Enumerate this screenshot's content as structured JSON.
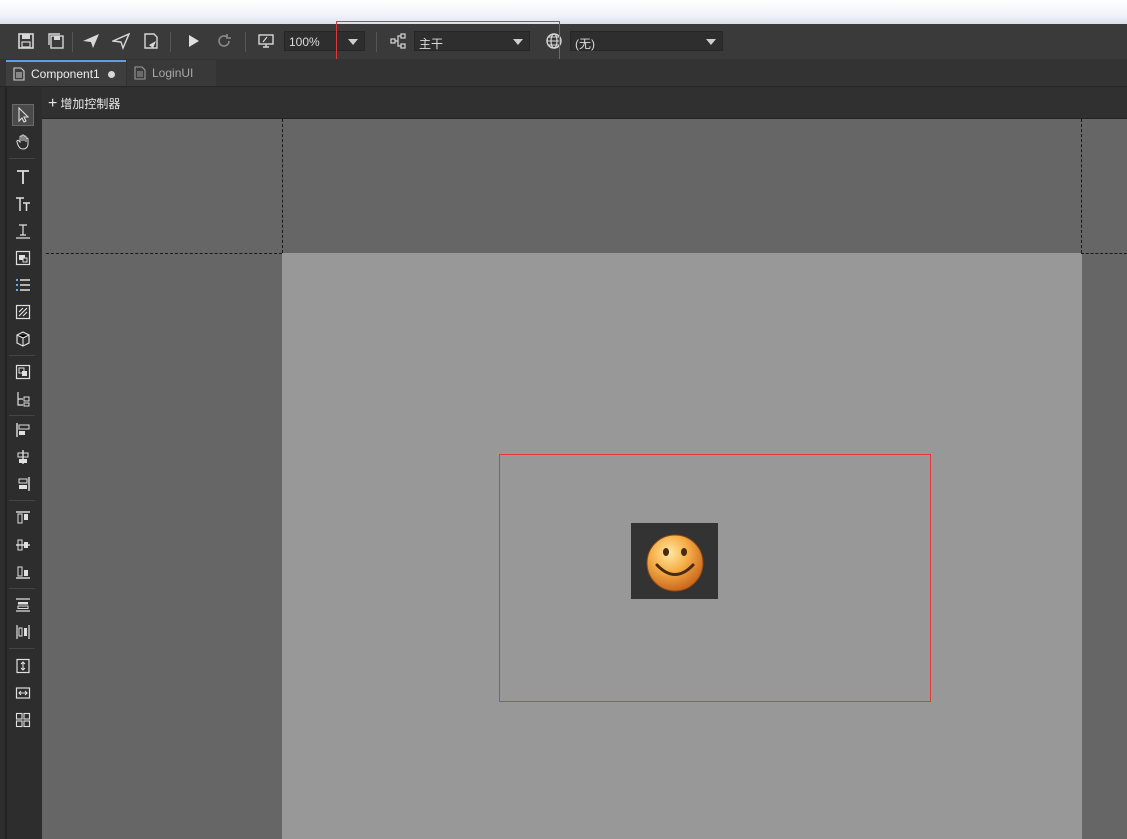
{
  "toolbar": {
    "icons": [
      "save-icon",
      "save-all-icon",
      "publish-icon",
      "publish-all-icon",
      "publish-doc-icon",
      "play-icon",
      "refresh-icon",
      "screen-icon",
      "branch-icon",
      "globe-icon"
    ],
    "zoom_value": "100%",
    "branch_value": "主干",
    "language_value": "(无)"
  },
  "tabs": [
    {
      "label": "Component1",
      "active": true,
      "modified": true
    },
    {
      "label": "LoginUI",
      "active": false,
      "modified": false
    }
  ],
  "controller_bar": {
    "add_label": "增加控制器"
  },
  "left_tools": [
    "select-arrow-icon",
    "hand-icon",
    "text-icon",
    "rich-text-icon",
    "input-text-icon",
    "loader-icon",
    "list-icon",
    "graph-icon",
    "component-3d-icon",
    "group-icon",
    "relation-icon",
    "align-left-icon",
    "align-center-h-icon",
    "align-right-icon",
    "align-top-icon",
    "align-middle-v-icon",
    "align-bottom-icon",
    "distribute-v-icon",
    "distribute-h-icon",
    "same-height-icon",
    "same-width-icon",
    "grid-icon"
  ],
  "colors": {
    "accent": "#5aa0e6",
    "selection": "#e23b3b",
    "stage": "#989898",
    "canvas": "#666666"
  }
}
